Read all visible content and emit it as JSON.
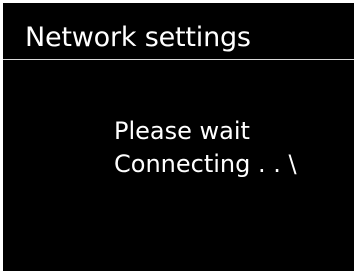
{
  "screen": {
    "title": "Network settings",
    "message_line_1": "Please wait",
    "message_line_2": "Connecting . . \\"
  },
  "colors": {
    "background": "#000000",
    "text": "#ffffff",
    "divider": "#d9d9d9",
    "frame": "#ffffff"
  }
}
